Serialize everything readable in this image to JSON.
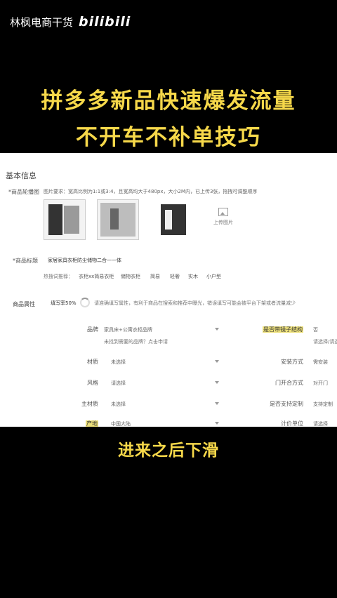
{
  "watermark": {
    "channel": "林枫电商干货",
    "platform_logo": "bilibili"
  },
  "headline": {
    "line1": "拼多多新品快速爆发流量",
    "line2": "不开车不补单技巧"
  },
  "form": {
    "section_title": "基本信息",
    "image_label": "*商品轮播图",
    "image_hint": "图片要求：宽高比例为1:1或3:4，且宽高均大于480px，大小2M内，已上传3张，拖拽可调整顺序",
    "upload_label": "上传图片",
    "title_label": "*商品标题",
    "title_value": "家居家具衣柜防尘储物二合一一体",
    "keyword_label": "热搜词推荐：",
    "keywords": [
      "衣柜xx简易衣柜",
      "储物衣柜",
      "简易",
      "轻奢",
      "实木",
      "小户型"
    ],
    "attr_label": "商品属性",
    "fill_rate": "填写率50%",
    "attr_note": "请准确填写属性，有利于商品在搜索和推荐中曝光，错误填写可能会被平台下架或者流量减少",
    "props": {
      "brand_label": "品牌",
      "brand_value": "家具床+公寓衣柜品牌",
      "brand_sub": "未找到需要的品牌？点击申请",
      "material_label": "材质",
      "material_value": "未选择",
      "style_label": "风格",
      "style_value": "请选择",
      "main_material_label": "主材质",
      "main_material_value": "未选择",
      "origin_label": "产地",
      "origin_value": "中国大陆",
      "structure_label": "是否带镜子结构",
      "structure_value": "否",
      "structure_sub": "请选择/请选择",
      "install_label": "安装方式",
      "install_value": "需安装",
      "door_label": "门开合方式",
      "door_value": "对开门",
      "frame_label": "是否支持定制",
      "frame_value": "支持定制",
      "unit_label": "计价单位",
      "unit_value": "请选择"
    }
  },
  "caption": "进来之后下滑"
}
